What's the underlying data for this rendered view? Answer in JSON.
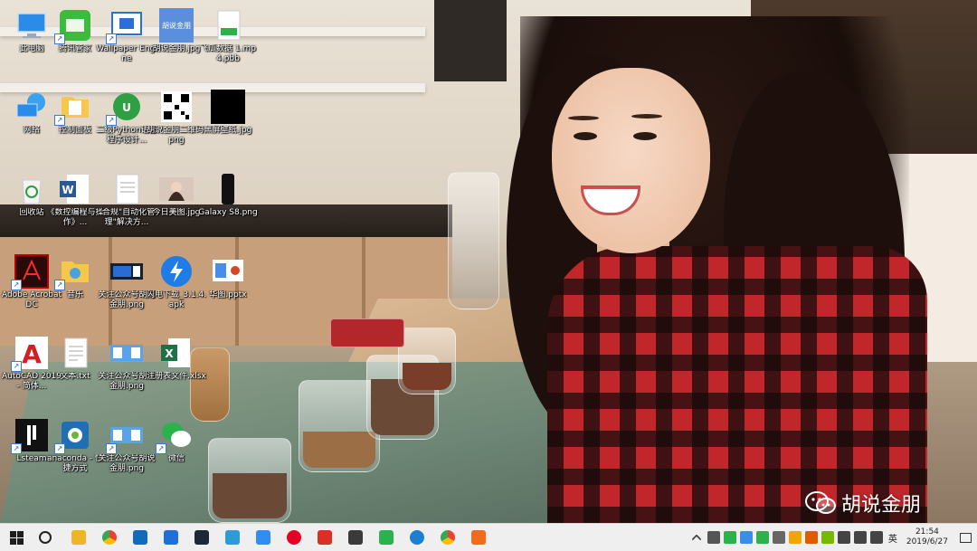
{
  "desktop_icons": [
    {
      "label": "此电脑",
      "icon": "this-pc-icon",
      "shortcut": false
    },
    {
      "label": "网络",
      "icon": "network-icon",
      "shortcut": false
    },
    {
      "label": "回收站",
      "icon": "recycle-bin-icon",
      "shortcut": false
    },
    {
      "label": "Adobe Acrobat DC",
      "icon": "acrobat-icon",
      "shortcut": true
    },
    {
      "label": "AutoCAD 2019 - 简体...",
      "icon": "autocad-icon",
      "shortcut": true
    },
    {
      "label": "Lsteam",
      "icon": "lsteam-icon",
      "shortcut": true
    },
    {
      "label": "腾讯管家",
      "icon": "tencent-manager-icon",
      "shortcut": true
    },
    {
      "label": "控制面板",
      "icon": "folder-icon",
      "shortcut": true
    },
    {
      "label": "《数控编程与操作》...",
      "icon": "word-icon",
      "shortcut": false
    },
    {
      "label": "音乐",
      "icon": "music-folder-icon",
      "shortcut": true
    },
    {
      "label": "文本.txt",
      "icon": "text-file-icon",
      "shortcut": false
    },
    {
      "label": "anaconda - 快捷方式",
      "icon": "anaconda-icon",
      "shortcut": true
    },
    {
      "label": "Wallpaper Engine",
      "icon": "wallpaper-engine-icon",
      "shortcut": true
    },
    {
      "label": "二级Python语言程序设计...",
      "icon": "python-exam-icon",
      "shortcut": true
    },
    {
      "label": "\"合规\"自动化管理\"解决方...",
      "icon": "document-icon",
      "shortcut": false
    },
    {
      "label": "关注公众号胡说金朋.png",
      "icon": "image-card-icon",
      "shortcut": false
    },
    {
      "label": "关注公众号胡说金朋.png",
      "icon": "image-card-blue-icon",
      "shortcut": false
    },
    {
      "label": "关注公众号胡说金朋.png",
      "icon": "image-card-blue-icon",
      "shortcut": true
    },
    {
      "label": "胡说金朋.jpg",
      "icon": "hushuo-logo-icon",
      "shortcut": false
    },
    {
      "label": "胡说金朋二维码.png",
      "icon": "qrcode-icon",
      "shortcut": false
    },
    {
      "label": "今日美图.jpg",
      "icon": "photo-icon",
      "shortcut": false
    },
    {
      "label": "闪电下载_3.1.4.apk",
      "icon": "lightning-icon",
      "shortcut": false
    },
    {
      "label": "注册表文件.xlsx",
      "icon": "excel-icon",
      "shortcut": false
    },
    {
      "label": "微信",
      "icon": "wechat-icon",
      "shortcut": true
    },
    {
      "label": "飞瓜数据 1.mp4.pbb",
      "icon": "pbb-file-icon",
      "shortcut": false
    },
    {
      "label": "黑屏壁纸.jpg",
      "icon": "black-image-icon",
      "shortcut": false
    },
    {
      "label": "Galaxy S8.png",
      "icon": "phone-image-icon",
      "shortcut": false
    },
    {
      "label": "华图.pptx",
      "icon": "pptx-icon",
      "shortcut": false
    }
  ],
  "taskbar": {
    "apps": [
      {
        "icon": "file-explorer-icon",
        "color": "#f0b429"
      },
      {
        "icon": "chrome-icon",
        "color": "#4285f4"
      },
      {
        "icon": "store-icon",
        "color": "#0f6cbd"
      },
      {
        "icon": "remote-desktop-icon",
        "color": "#1e6fd9"
      },
      {
        "icon": "steam-icon",
        "color": "#1b2838"
      },
      {
        "icon": "edge-legacy-icon",
        "color": "#2f9bd6"
      },
      {
        "icon": "baidu-netdisk-icon",
        "color": "#2f8ef4"
      },
      {
        "icon": "netease-music-icon",
        "color": "#e60026"
      },
      {
        "icon": "pdf-reader-icon",
        "color": "#d93025"
      },
      {
        "icon": "gold-app-icon",
        "color": "#3a3a3a"
      },
      {
        "icon": "wechat-icon",
        "color": "#2ab34a"
      },
      {
        "icon": "ie-icon",
        "color": "#1c7fd4"
      },
      {
        "icon": "chrome-icon",
        "color": "#34a853"
      },
      {
        "icon": "sogou-icon",
        "color": "#f26b1d"
      }
    ],
    "tray": [
      {
        "icon": "chevron-up-icon",
        "color": "#444"
      },
      {
        "icon": "steam-tray-icon",
        "color": "#555"
      },
      {
        "icon": "wechat-tray-icon",
        "color": "#2ab34a"
      },
      {
        "icon": "security-tray-icon",
        "color": "#3a8ee6"
      },
      {
        "icon": "app-tray-icon",
        "color": "#2ab34a"
      },
      {
        "icon": "gear-tray-icon",
        "color": "#666"
      },
      {
        "icon": "folder-tray-icon",
        "color": "#f0a500"
      },
      {
        "icon": "shield-tray-icon",
        "color": "#e05a00"
      },
      {
        "icon": "nvidia-tray-icon",
        "color": "#76b900"
      },
      {
        "icon": "battery-icon",
        "color": "#444"
      },
      {
        "icon": "network-tray-icon",
        "color": "#444"
      },
      {
        "icon": "volume-icon",
        "color": "#444"
      }
    ],
    "ime": "英",
    "time": "21:54",
    "date": "2019/6/27"
  },
  "watermark": {
    "text": "胡说金朋"
  }
}
